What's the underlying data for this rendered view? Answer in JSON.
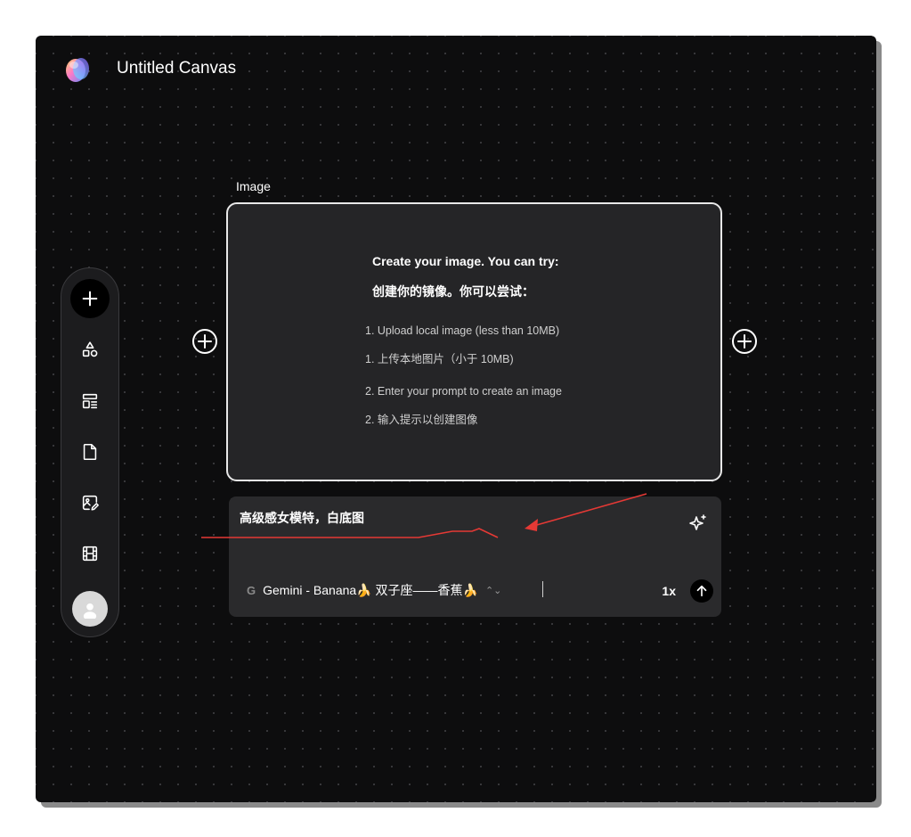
{
  "canvas": {
    "title": "Untitled Canvas"
  },
  "node": {
    "label": "Image",
    "heading_en": "Create your image. You can try:",
    "heading_zh": "创建你的镜像。你可以尝试：",
    "steps": [
      "1. Upload local image (less than 10MB)",
      "1. 上传本地图片（小于 10MB)",
      "2. Enter your prompt to create an image",
      "2. 输入提示以创建图像"
    ]
  },
  "prompt": {
    "text": "高级感女模特，白底图",
    "model_provider_icon": "G",
    "model_name": "Gemini - Banana🍌 双子座——香蕉🍌",
    "model_caret": "⌃⌄",
    "count": "1x"
  },
  "toolbar": {
    "items": [
      "add-icon",
      "shapes-icon",
      "layout-icon",
      "document-icon",
      "image-edit-icon",
      "film-icon",
      "avatar"
    ]
  },
  "colors": {
    "canvas_bg": "#0d0d0e",
    "card_bg": "#252527",
    "panel_bg": "#2a2a2c",
    "annotation_red": "#e53935"
  }
}
